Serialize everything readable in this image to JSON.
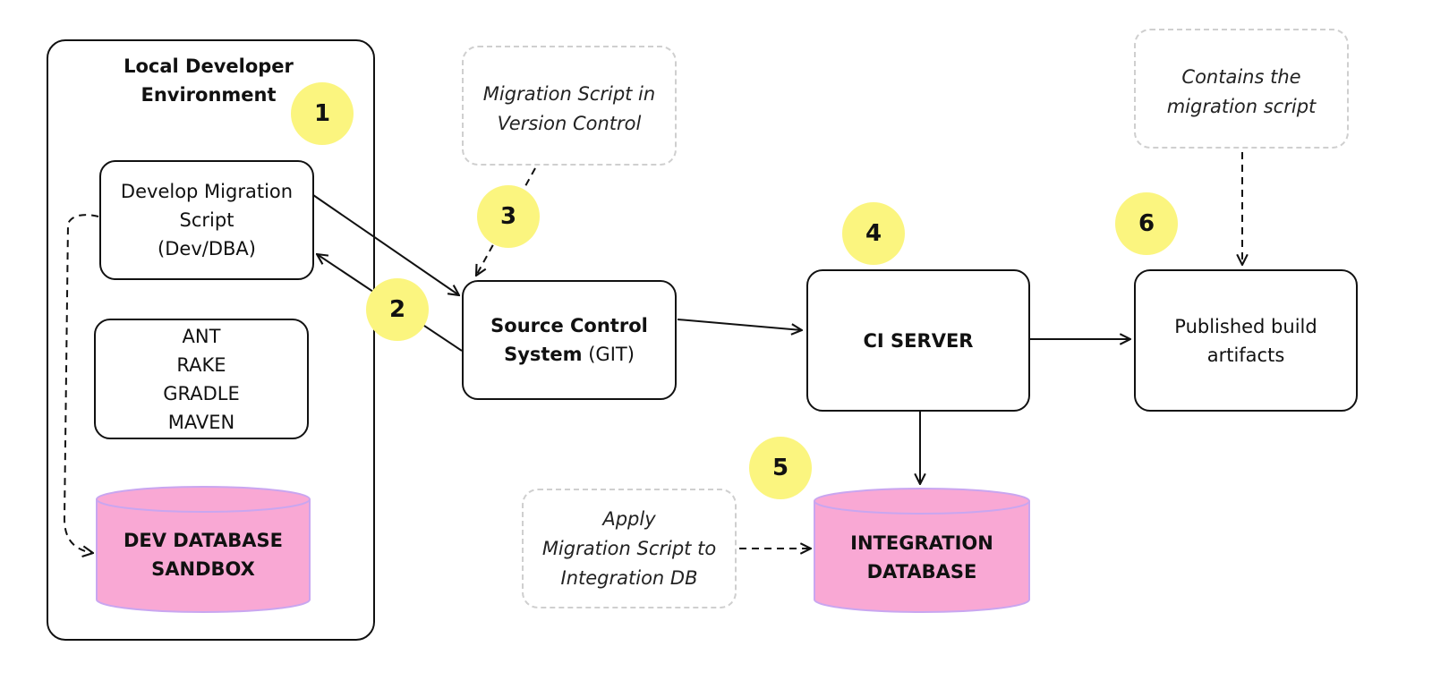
{
  "diagram": {
    "local_env": {
      "title_lines": [
        "Local Developer",
        "Environment"
      ],
      "develop_box": [
        "Develop Migration",
        "Script",
        "(Dev/DBA)"
      ],
      "build_tools": [
        "ANT",
        "RAKE",
        "GRADLE",
        "MAVEN"
      ],
      "dev_db": [
        "DEV DATABASE",
        "SANDBOX"
      ]
    },
    "source_control": {
      "bold_line1": "Source Control",
      "bold_line2": "System",
      "suffix": " (GIT)"
    },
    "ci_server": {
      "label": "CI SERVER"
    },
    "artifacts": {
      "lines": [
        "Published build",
        "artifacts"
      ]
    },
    "integration_db": {
      "lines": [
        "INTEGRATION",
        "DATABASE"
      ]
    },
    "notes": {
      "version_control": [
        "Migration Script in",
        "Version Control"
      ],
      "contains": [
        "Contains the",
        "migration script"
      ],
      "apply": [
        "Apply",
        "Migration Script to",
        "Integration DB"
      ]
    },
    "badges": [
      "1",
      "2",
      "3",
      "4",
      "5",
      "6"
    ],
    "colors": {
      "badge": "#fbf57f",
      "database_fill": "#f9a8d4",
      "database_stroke": "#c9a6f0",
      "note_border": "#cfcfcf",
      "line": "#111111"
    }
  }
}
